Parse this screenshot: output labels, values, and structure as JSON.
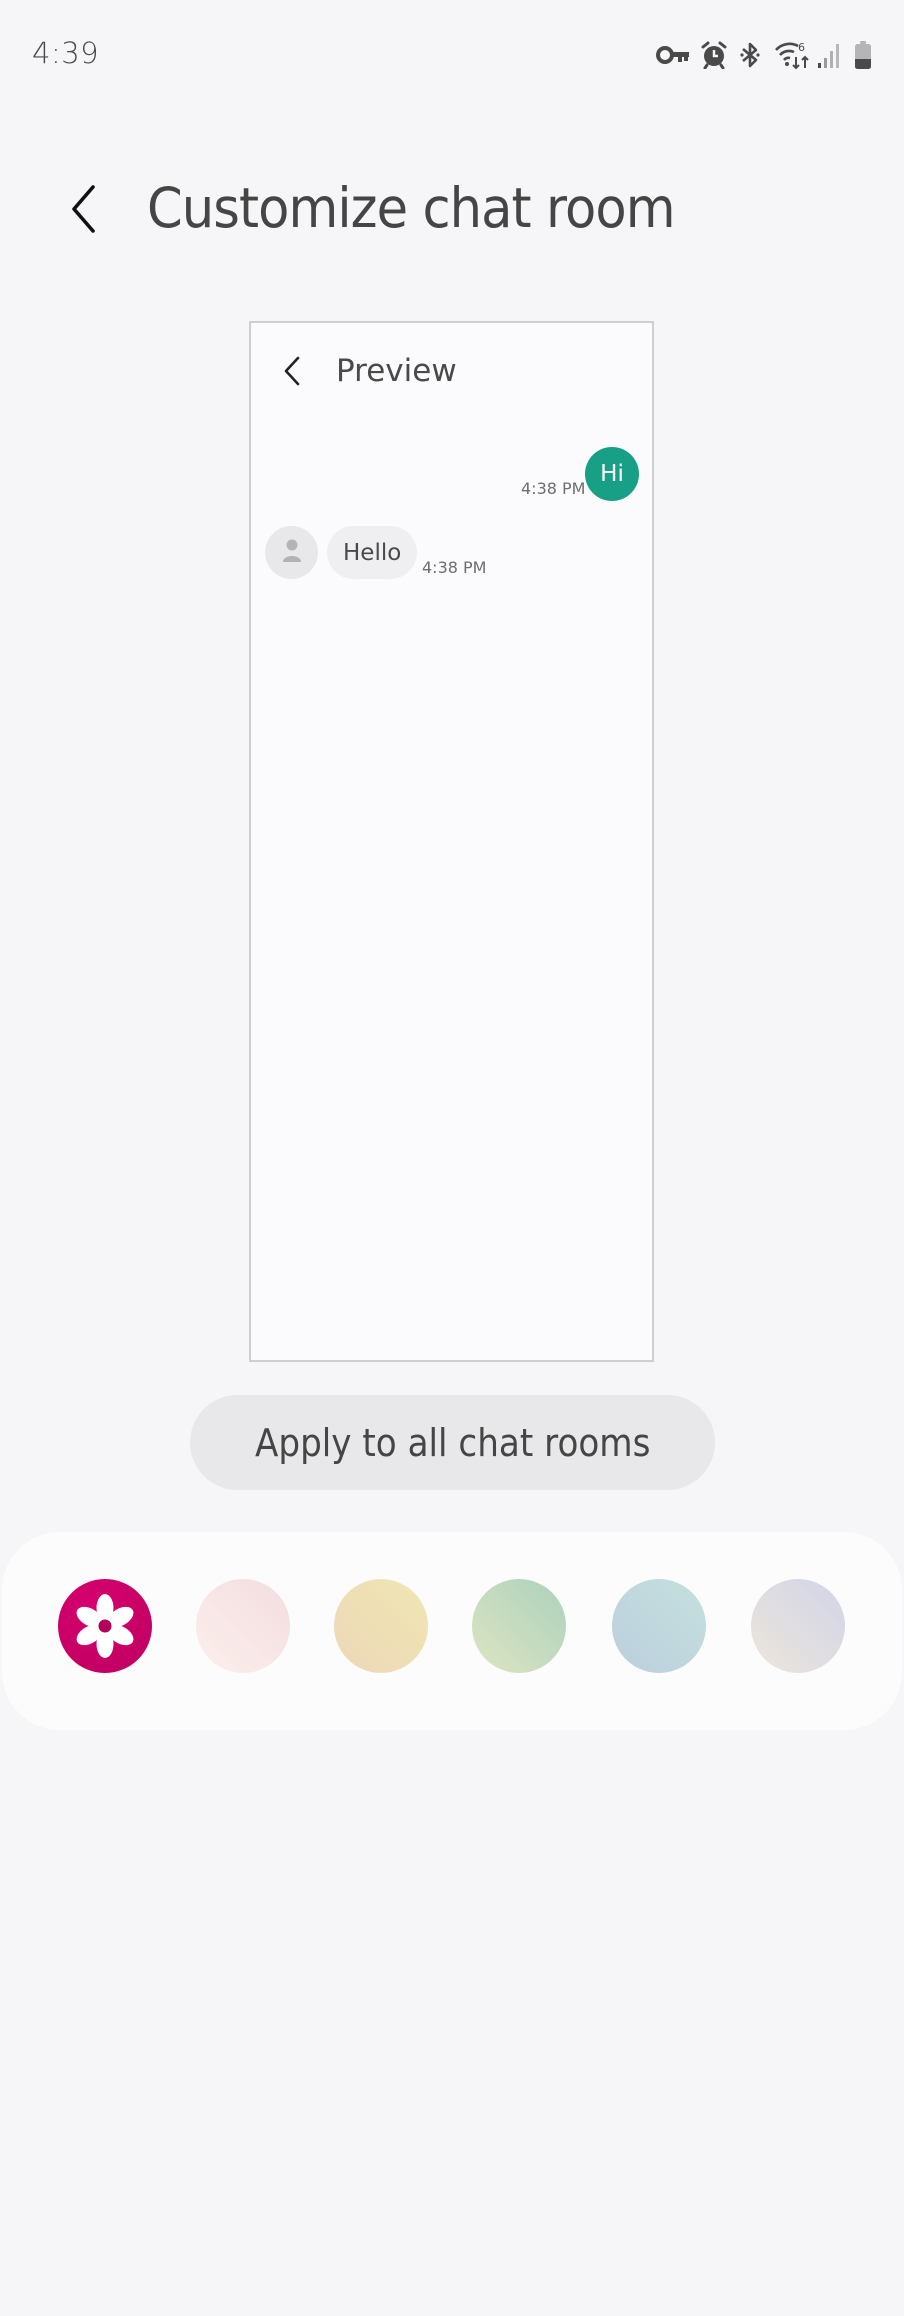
{
  "status_bar": {
    "time": "4:39",
    "icons": [
      "vpn-key-icon",
      "alarm-icon",
      "bluetooth-icon",
      "wifi-6-icon",
      "signal-icon",
      "battery-icon"
    ]
  },
  "header": {
    "back_icon": "chevron-left-icon",
    "title": "Customize chat room"
  },
  "preview": {
    "back_icon": "chevron-left-icon",
    "title": "Preview",
    "sent_message": {
      "text": "Hi",
      "time": "4:38 PM",
      "color": "#17a085"
    },
    "received_message": {
      "avatar_icon": "person-icon",
      "text": "Hello",
      "time": "4:38 PM"
    }
  },
  "apply_button": {
    "label": "Apply to all chat rooms"
  },
  "themes": {
    "selected_index": 0,
    "swatches": [
      {
        "name": "flower",
        "icon": "flower-icon",
        "colors": [
          "#d7006f",
          "#c4005f"
        ]
      },
      {
        "name": "pink",
        "colors": [
          "#fbf0ec",
          "#f4dcdf"
        ]
      },
      {
        "name": "yellow",
        "colors": [
          "#ecd8b8",
          "#f0e6b2"
        ]
      },
      {
        "name": "green",
        "colors": [
          "#dde5c2",
          "#acd1bc"
        ]
      },
      {
        "name": "blue",
        "colors": [
          "#bccfdf",
          "#c5e0dc"
        ]
      },
      {
        "name": "lavender",
        "colors": [
          "#ece6da",
          "#d2d4e8"
        ]
      }
    ]
  }
}
